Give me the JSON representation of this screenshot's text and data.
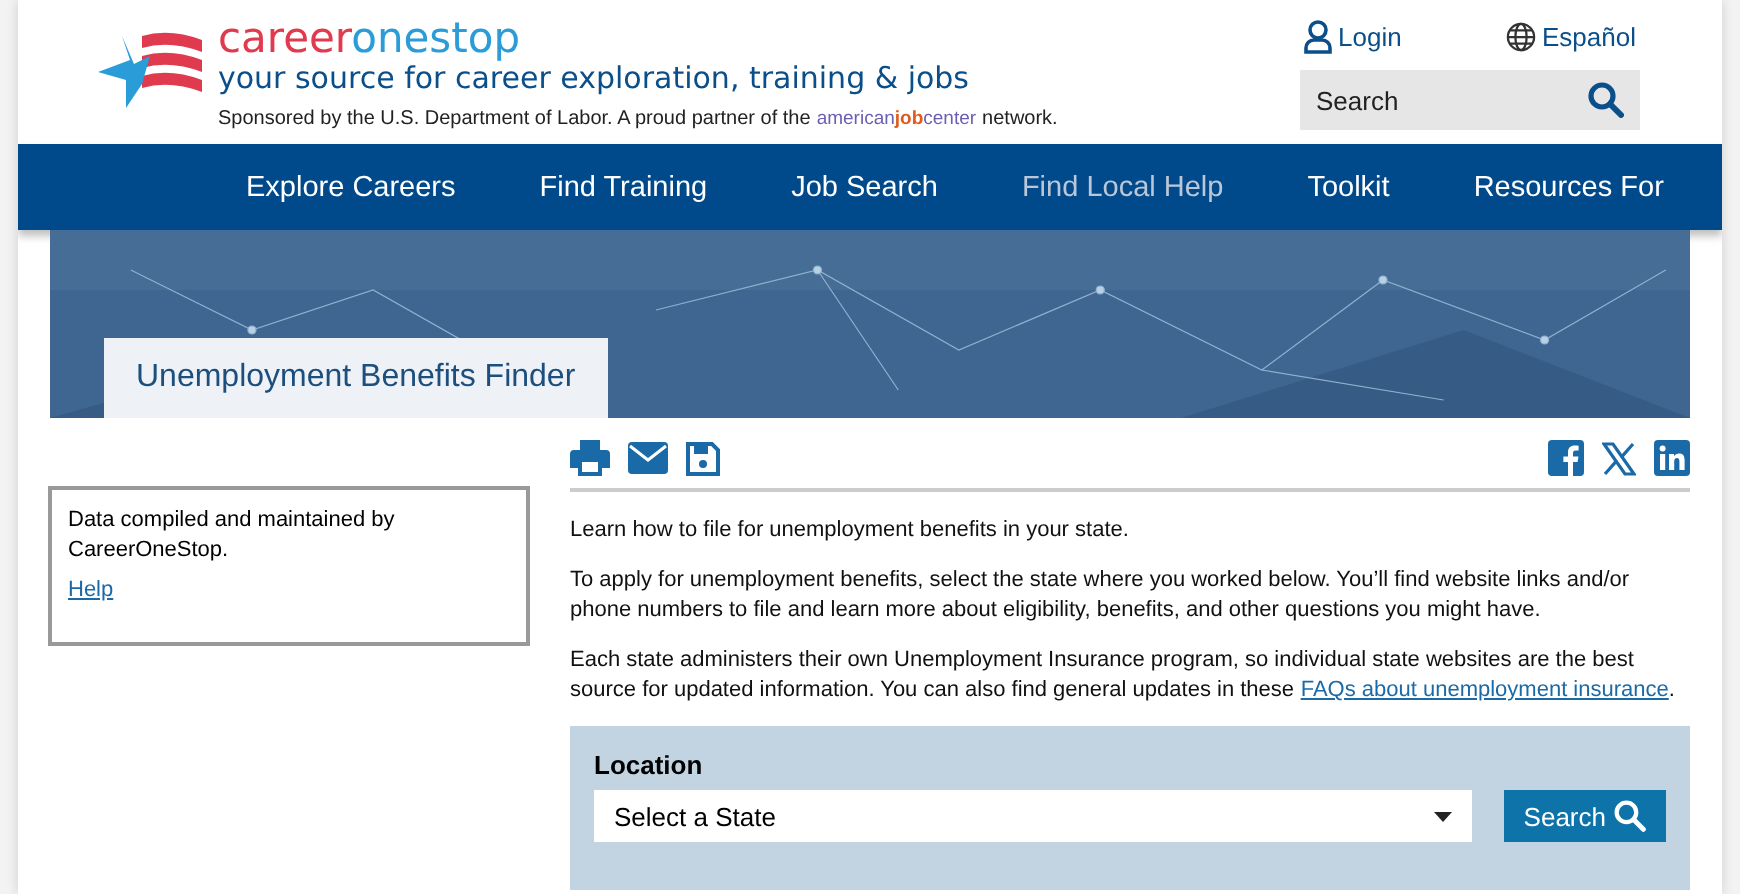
{
  "header": {
    "logo_first": "career",
    "logo_second": "onestop",
    "tagline": "your source for career exploration, training & jobs",
    "sponsor_before": "Sponsored by the U.S. Department of Labor. A proud partner of the",
    "partner_parts": [
      "american",
      "job",
      "center"
    ],
    "sponsor_after": "network.",
    "login": "Login",
    "language": "Español",
    "search_placeholder": "Search"
  },
  "nav": [
    {
      "label": "Explore Careers",
      "selected": false
    },
    {
      "label": "Find Training",
      "selected": false
    },
    {
      "label": "Job Search",
      "selected": false
    },
    {
      "label": "Find Local Help",
      "selected": true
    },
    {
      "label": "Toolkit",
      "selected": false
    },
    {
      "label": "Resources For",
      "selected": false
    }
  ],
  "banner": {
    "title": "Unemployment Benefits Finder"
  },
  "sidebar": {
    "text": "Data compiled and maintained by CareerOneStop.",
    "link": "Help"
  },
  "paragraphs": [
    {
      "text": "Learn how to file for unemployment benefits in your state."
    },
    {
      "text": "To apply for unemployment benefits, select the state where you worked below. You’ll find website links and/or phone numbers to file and learn more about eligibility, benefits, and other questions you might have."
    },
    {
      "text": "Each state administers their own Unemployment Insurance program, so individual state websites are the best source for updated information. You can also find general updates in these",
      "link": "FAQs about unemployment insurance",
      "after": "."
    }
  ],
  "location": {
    "label": "Location",
    "select": "Select a State",
    "button": "Search"
  }
}
